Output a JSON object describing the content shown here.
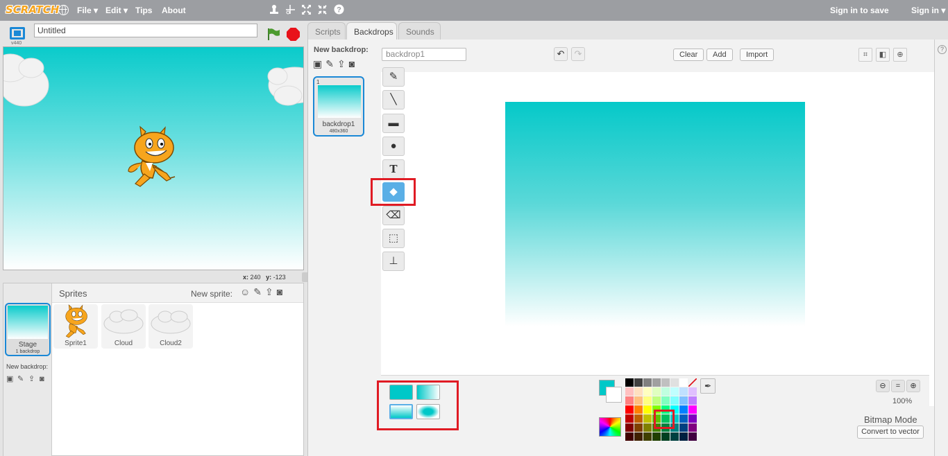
{
  "menubar": {
    "logo": "SCRATCH",
    "menus": [
      "File",
      "Edit",
      "Tips",
      "About"
    ],
    "sign_in_to_save": "Sign in to save",
    "sign_in": "Sign in"
  },
  "stage": {
    "project_title": "Untitled",
    "version": "v440",
    "coords": {
      "x_label": "x:",
      "x": "240",
      "y_label": "y:",
      "y": "-123"
    }
  },
  "sprites": {
    "header": "Sprites",
    "new_sprite_label": "New sprite:",
    "items": [
      {
        "name": "Sprite1"
      },
      {
        "name": "Cloud"
      },
      {
        "name": "Cloud2"
      }
    ],
    "stage_card": {
      "label": "Stage",
      "sub": "1 backdrop"
    },
    "new_backdrop_small": "New backdrop:"
  },
  "tabs": {
    "scripts": "Scripts",
    "backdrops": "Backdrops",
    "sounds": "Sounds"
  },
  "backdrops": {
    "new_backdrop_label": "New backdrop:",
    "items": [
      {
        "index": "1",
        "name": "backdrop1",
        "size": "480x360"
      }
    ]
  },
  "paint_editor": {
    "costume_name": "backdrop1",
    "buttons": {
      "clear": "Clear",
      "add": "Add",
      "import": "Import"
    },
    "zoom_level": "100%",
    "mode_label": "Bitmap Mode",
    "convert_button": "Convert to vector",
    "active_tool": "fill-bucket",
    "primary_color": "#00c8c8",
    "secondary_color": "#ffffff"
  },
  "colors": {
    "menubar": "#9c9ea2",
    "accent_blue": "#1a88d6",
    "highlight_red": "#e01b24",
    "stage_top": "#0acbcb"
  }
}
